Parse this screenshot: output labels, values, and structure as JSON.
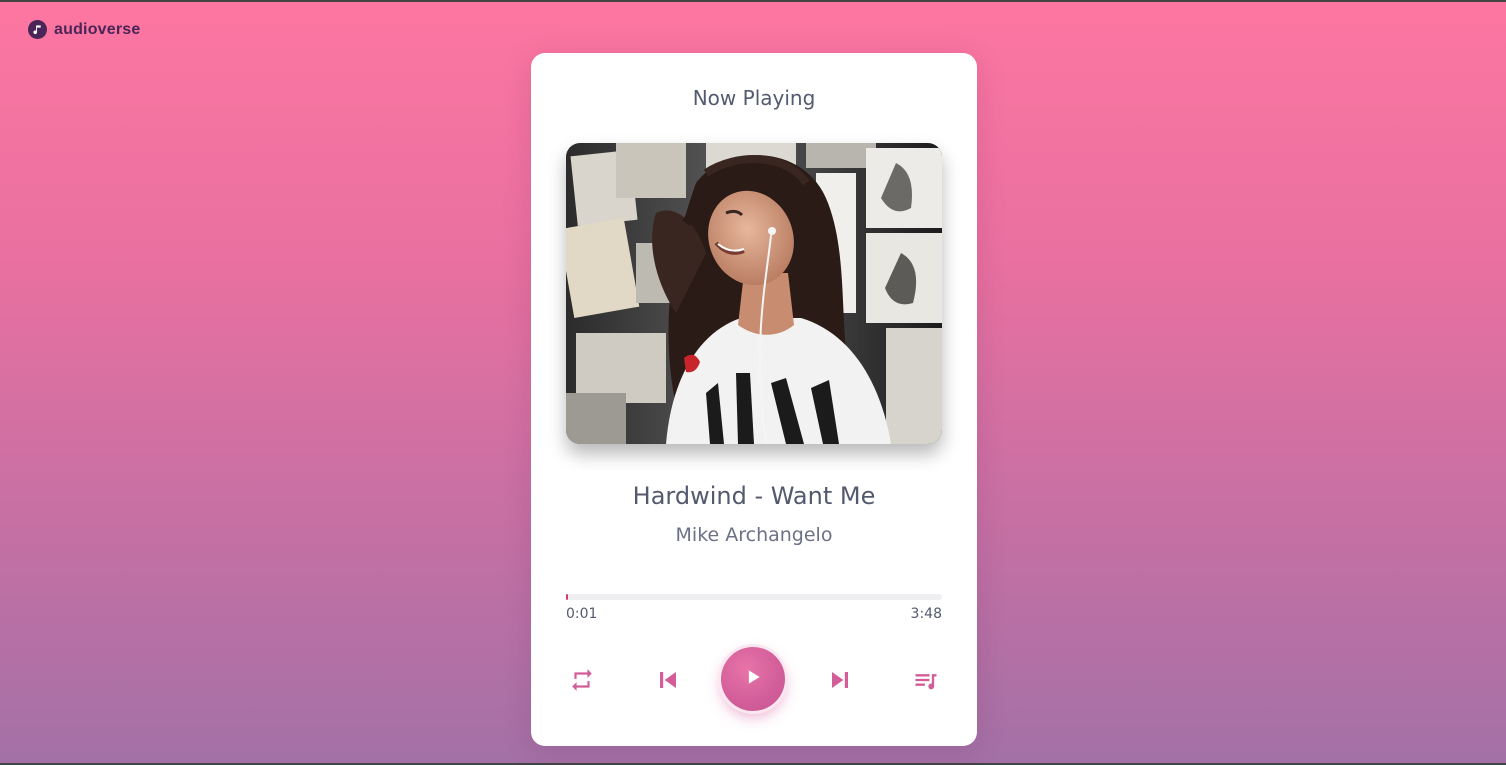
{
  "app": {
    "brand_name": "audioverse",
    "brand_icon": "music-note-icon"
  },
  "player": {
    "heading": "Now Playing",
    "track_title": "Hardwind - Want Me",
    "artist": "Mike Archangelo",
    "progress": {
      "current_time": "0:01",
      "total_time": "3:48",
      "fraction": 0.004
    },
    "controls": {
      "repeat_icon": "repeat-icon",
      "previous_icon": "skip-previous-icon",
      "play_icon": "play-icon",
      "next_icon": "skip-next-icon",
      "playlist_icon": "playlist-icon"
    }
  },
  "colors": {
    "accent": "#d25d99",
    "progress": "#d33a76",
    "text": "#545a6e",
    "brand": "#4a2557",
    "background_top": "#fd76a1",
    "background_bottom": "#a371a6"
  }
}
